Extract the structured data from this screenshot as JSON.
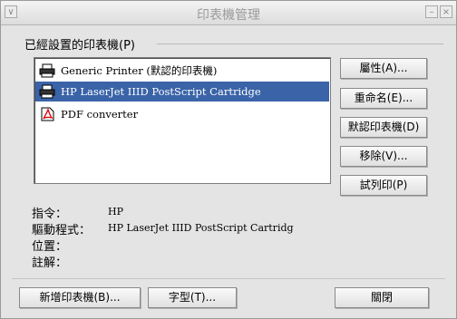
{
  "window": {
    "title": "印表機管理",
    "menu_glyph": "∨",
    "minimize_glyph": "–",
    "close_glyph": "×"
  },
  "printers_group": {
    "label": "已經設置的印表機(P)"
  },
  "printers": [
    {
      "name": "Generic Printer (默認的印表機)",
      "icon": "printer-icon",
      "selected": false
    },
    {
      "name": "HP LaserJet IIID PostScript Cartridge",
      "icon": "printer-icon",
      "selected": true
    },
    {
      "name": "PDF converter",
      "icon": "pdf-icon",
      "selected": false
    }
  ],
  "side_buttons": {
    "properties": "屬性(A)...",
    "rename": "重命名(E)...",
    "default": "默認印表機(D)",
    "remove": "移除(V)...",
    "test": "試列印(P)"
  },
  "details": {
    "command_label": "指令：",
    "command_value": "HP",
    "driver_label": "驅動程式：",
    "driver_value": "HP LaserJet IIID PostScript Cartridg",
    "location_label": "位置：",
    "comment_label": "註解："
  },
  "bottom_buttons": {
    "add_printer": "新增印表機(B)...",
    "font": "字型(T)...",
    "close": "關閉"
  },
  "colors": {
    "selection": "#3a63a8",
    "window_bg": "#e4e4e4"
  }
}
